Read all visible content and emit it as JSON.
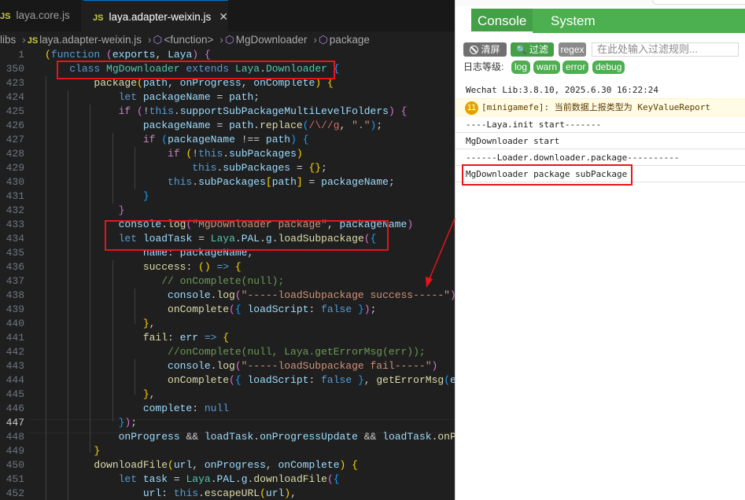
{
  "editor": {
    "tabs": [
      {
        "icon": "JS",
        "label": "laya.core.js",
        "active": false
      },
      {
        "icon": "JS",
        "label": "laya.adapter-weixin.js",
        "active": true,
        "close": "✕"
      }
    ],
    "breadcrumb": [
      "libs",
      "laya.adapter-weixin.js",
      "<function>",
      "MgDownloader",
      "package"
    ],
    "lines": [
      {
        "n": "1",
        "html": "<span class='bg'>(</span><span class='k'>function</span> <span class='bp'>(</span><span class='v'>exports</span>, <span class='v'>Laya</span><span class='bp'>)</span> <span class='bp'>{</span>"
      },
      {
        "n": "350",
        "html": "    <span class='k'>class</span> <span class='t'>MgDownloader</span> <span class='k'>extends</span> <span class='t'>Laya</span>.<span class='t'>Downloader</span> <span class='bb'>{</span>"
      },
      {
        "n": "423",
        "html": "        <span class='f'>package</span><span class='bg'>(</span><span class='v'>path</span>, <span class='v'>onProgress</span>, <span class='v'>onComplete</span><span class='bg'>)</span> <span class='bg'>{</span>"
      },
      {
        "n": "424",
        "html": "            <span class='k'>let</span> <span class='v'>packageName</span> = <span class='v'>path</span>;"
      },
      {
        "n": "425",
        "html": "            <span class='c'>if</span> <span class='bp'>(</span>!<span class='k'>this</span>.<span class='v'>supportSubPackageMultiLevelFolders</span><span class='bp'>)</span> <span class='bp'>{</span>"
      },
      {
        "n": "426",
        "html": "                <span class='v'>packageName</span> = <span class='v'>path</span>.<span class='f'>replace</span><span class='bb'>(</span><span class='r'>/\\//g</span>, <span class='s'>\".\"</span><span class='bb'>)</span>;"
      },
      {
        "n": "427",
        "html": "                <span class='c'>if</span> <span class='bb'>(</span><span class='v'>packageName</span> !== <span class='v'>path</span><span class='bb'>)</span> <span class='bb'>{</span>"
      },
      {
        "n": "428",
        "html": "                    <span class='c'>if</span> <span class='bg'>(</span>!<span class='k'>this</span>.<span class='v'>subPackages</span><span class='bg'>)</span>"
      },
      {
        "n": "429",
        "html": "                        <span class='k'>this</span>.<span class='v'>subPackages</span> = <span class='bg'>{}</span>;"
      },
      {
        "n": "430",
        "html": "                    <span class='k'>this</span>.<span class='v'>subPackages</span><span class='bg'>[</span><span class='v'>path</span><span class='bg'>]</span> = <span class='v'>packageName</span>;"
      },
      {
        "n": "431",
        "html": "                <span class='bb'>}</span>"
      },
      {
        "n": "432",
        "html": "            <span class='bp'>}</span>"
      },
      {
        "n": "433",
        "html": "            <span class='v'>console</span>.<span class='f'>log</span><span class='bp'>(</span><span class='s'>\"MgDownloader package\"</span>, <span class='v'>packageName</span><span class='bp'>)</span>"
      },
      {
        "n": "434",
        "html": "            <span class='k'>let</span> <span class='v'>loadTask</span> = <span class='t'>Laya</span>.<span class='v'>PAL</span>.<span class='v'>g</span>.<span class='f'>loadSubpackage</span><span class='bp'>(</span><span class='bb'>{</span>"
      },
      {
        "n": "435",
        "html": "                <span class='v'>name</span>: <span class='v'>packageName</span>,"
      },
      {
        "n": "436",
        "html": "                <span class='f'>success</span>: <span class='bg'>()</span> <span class='k'>=&gt;</span> <span class='bg'>{</span>"
      },
      {
        "n": "437",
        "html": "                   <span class='cm'>// onComplete(null);</span>"
      },
      {
        "n": "438",
        "html": "                    <span class='v'>console</span>.<span class='f'>log</span><span class='bp'>(</span><span class='s'>\"-----loadSubpackage success-----\"</span><span class='bp'>)</span>"
      },
      {
        "n": "439",
        "html": "                    <span class='f'>onComplete</span><span class='bp'>(</span><span class='bb'>{</span> <span class='v'>loadScript</span>: <span class='k'>false</span> <span class='bb'>}</span><span class='bp'>)</span>;"
      },
      {
        "n": "440",
        "html": "                <span class='bg'>}</span>,"
      },
      {
        "n": "441",
        "html": "                <span class='f'>fail</span>: <span class='v'>err</span> <span class='k'>=&gt;</span> <span class='bg'>{</span>"
      },
      {
        "n": "442",
        "html": "                    <span class='cm'>//onComplete(null, Laya.getErrorMsg(err));</span>"
      },
      {
        "n": "443",
        "html": "                    <span class='v'>console</span>.<span class='f'>log</span><span class='bp'>(</span><span class='s'>\"-----loadSubpackage fail-----\"</span><span class='bp'>)</span>"
      },
      {
        "n": "444",
        "html": "                    <span class='f'>onComplete</span><span class='bp'>(</span><span class='bb'>{</span> <span class='v'>loadScript</span>: <span class='k'>false</span> <span class='bb'>}</span>, <span class='f'>getErrorMsg</span><span class='bb'>(</span><span class='v'>err</span><span class='bb'>)</span><span class='bp'>)</span>;"
      },
      {
        "n": "445",
        "html": "                <span class='bg'>}</span>,"
      },
      {
        "n": "446",
        "html": "                <span class='v'>complete</span>: <span class='k'>null</span>"
      },
      {
        "n": "447",
        "html": "            <span class='bb'>}</span><span class='bp'>)</span>;"
      },
      {
        "n": "448",
        "html": "            <span class='v'>onProgress</span> &amp;&amp; <span class='v'>loadTask</span>.<span class='v'>onProgressUpdate</span> &amp;&amp; <span class='v'>loadTask</span>.<span class='f'>onProgress</span>"
      },
      {
        "n": "449",
        "html": "        <span class='bg'>}</span>"
      },
      {
        "n": "450",
        "html": "        <span class='f'>downloadFile</span><span class='bg'>(</span><span class='v'>url</span>, <span class='v'>onProgress</span>, <span class='v'>onComplete</span><span class='bg'>)</span> <span class='bg'>{</span>"
      },
      {
        "n": "451",
        "html": "            <span class='k'>let</span> <span class='v'>task</span> = <span class='t'>Laya</span>.<span class='v'>PAL</span>.<span class='v'>g</span>.<span class='f'>downloadFile</span><span class='bp'>(</span><span class='bb'>{</span>"
      },
      {
        "n": "452",
        "html": "                <span class='v'>url</span>: <span class='k'>this</span>.<span class='f'>escapeURL</span><span class='bg'>(</span><span class='v'>url</span><span class='bg'>)</span>,"
      }
    ],
    "current_line": "447"
  },
  "console": {
    "tabs": [
      "Console",
      "System"
    ],
    "active_tab": "Console",
    "toolbar": {
      "clear_label": "清屏",
      "filter_label": "过滤",
      "regex_label": "regex",
      "filter_placeholder": "在此处输入过滤规则..."
    },
    "levels_label": "日志等级:",
    "levels": [
      "log",
      "warn",
      "error",
      "debug"
    ],
    "entries": [
      {
        "text": "Wechat Lib:3.8.10, 2025.6.30 16:22:24",
        "type": "log"
      },
      {
        "text": "[minigamefe]: 当前数据上报类型为 KeyValueReport",
        "type": "warn",
        "count": "11"
      },
      {
        "text": "----Laya.init start-------",
        "type": "log"
      },
      {
        "text": "MgDownloader start",
        "type": "log"
      },
      {
        "text": "------Loader.downloader.package----------",
        "type": "log"
      },
      {
        "text": "MgDownloader package subPackage",
        "type": "log"
      }
    ]
  },
  "colors": {
    "highlight_box": "#e8141a",
    "console_green": "#4caf50",
    "warn_badge": "#e5a000"
  }
}
